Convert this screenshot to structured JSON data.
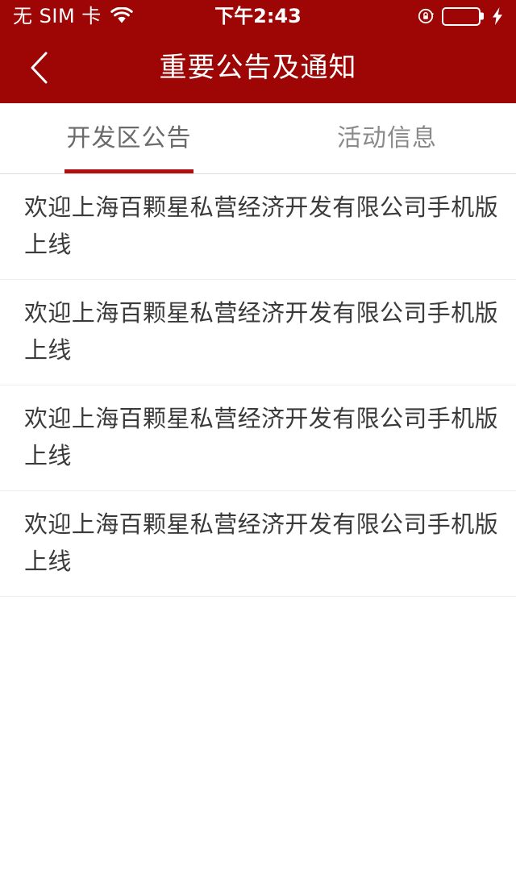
{
  "theme": {
    "brand_red": "#9e0505",
    "accent_red": "#b01010",
    "battery_green": "#4cd764",
    "text_dark": "#3a3a3a",
    "tab_inactive": "#8a8a8a"
  },
  "status_bar": {
    "carrier": "无 SIM 卡",
    "wifi_icon": "wifi-icon",
    "time": "下午2:43",
    "rotation_lock_icon": "rotation-lock-icon",
    "battery_icon": "battery-icon",
    "battery_level_percent": 100,
    "charging_icon": "lightning-bolt-icon"
  },
  "nav_bar": {
    "back_icon": "chevron-left-icon",
    "title": "重要公告及通知"
  },
  "tabs": [
    {
      "label": "开发区公告",
      "active": true
    },
    {
      "label": "活动信息",
      "active": false
    }
  ],
  "list": {
    "items": [
      {
        "title": "欢迎上海百颗星私营经济开发有限公司手机版上线"
      },
      {
        "title": "欢迎上海百颗星私营经济开发有限公司手机版上线"
      },
      {
        "title": "欢迎上海百颗星私营经济开发有限公司手机版上线"
      },
      {
        "title": "欢迎上海百颗星私营经济开发有限公司手机版上线"
      }
    ]
  }
}
